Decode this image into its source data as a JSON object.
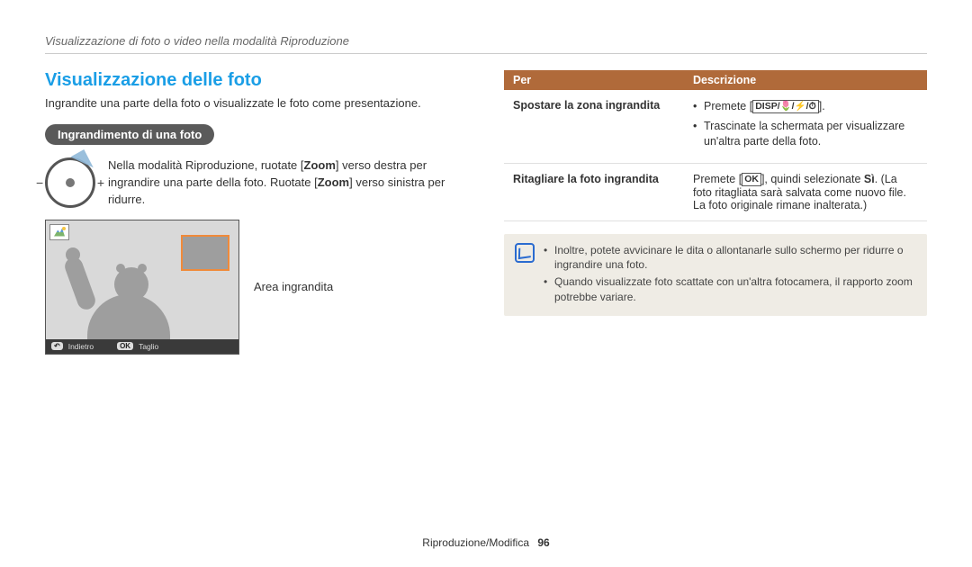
{
  "breadcrumb": "Visualizzazione di foto o video nella modalità Riproduzione",
  "section_title": "Visualizzazione delle foto",
  "intro": "Ingrandite una parte della foto o visualizzate le foto come presentazione.",
  "pill": "Ingrandimento di una foto",
  "zoom_instruction_pre": "Nella modalità Riproduzione, ruotate [",
  "zoom_kw1": "Zoom",
  "zoom_instruction_mid": "] verso destra per ingrandire una parte della foto. Ruotate [",
  "zoom_kw2": "Zoom",
  "zoom_instruction_post": "] verso sinistra per ridurre.",
  "minus": "−",
  "plus": "+",
  "callout": "Area ingrandita",
  "preview_footer": {
    "back_key": "↶",
    "back_label": "Indietro",
    "ok_key": "OK",
    "ok_label": "Taglio"
  },
  "table": {
    "head_col1": "Per",
    "head_col2": "Descrizione",
    "row1": {
      "key": "Spostare la zona ingrandita",
      "b1_pre": "Premete [",
      "b1_icons": "DISP/🌷/⚡/⏱",
      "b1_post": "].",
      "b2": "Trascinate la schermata per visualizzare un'altra parte della foto."
    },
    "row2": {
      "key": "Ritagliare la foto ingrandita",
      "pre": "Premete [",
      "icon": "OK",
      "mid1": "], quindi selezionate ",
      "si": "Sì",
      "mid2": ". (La foto ritagliata sarà salvata come nuovo file. La foto originale rimane inalterata.)"
    }
  },
  "tip": {
    "b1": "Inoltre, potete avvicinare le dita o allontanarle sullo schermo per ridurre o ingrandire una foto.",
    "b2": "Quando visualizzate foto scattate con un'altra fotocamera, il rapporto zoom potrebbe variare."
  },
  "footer": {
    "section": "Riproduzione/Modifica",
    "page": "96"
  }
}
